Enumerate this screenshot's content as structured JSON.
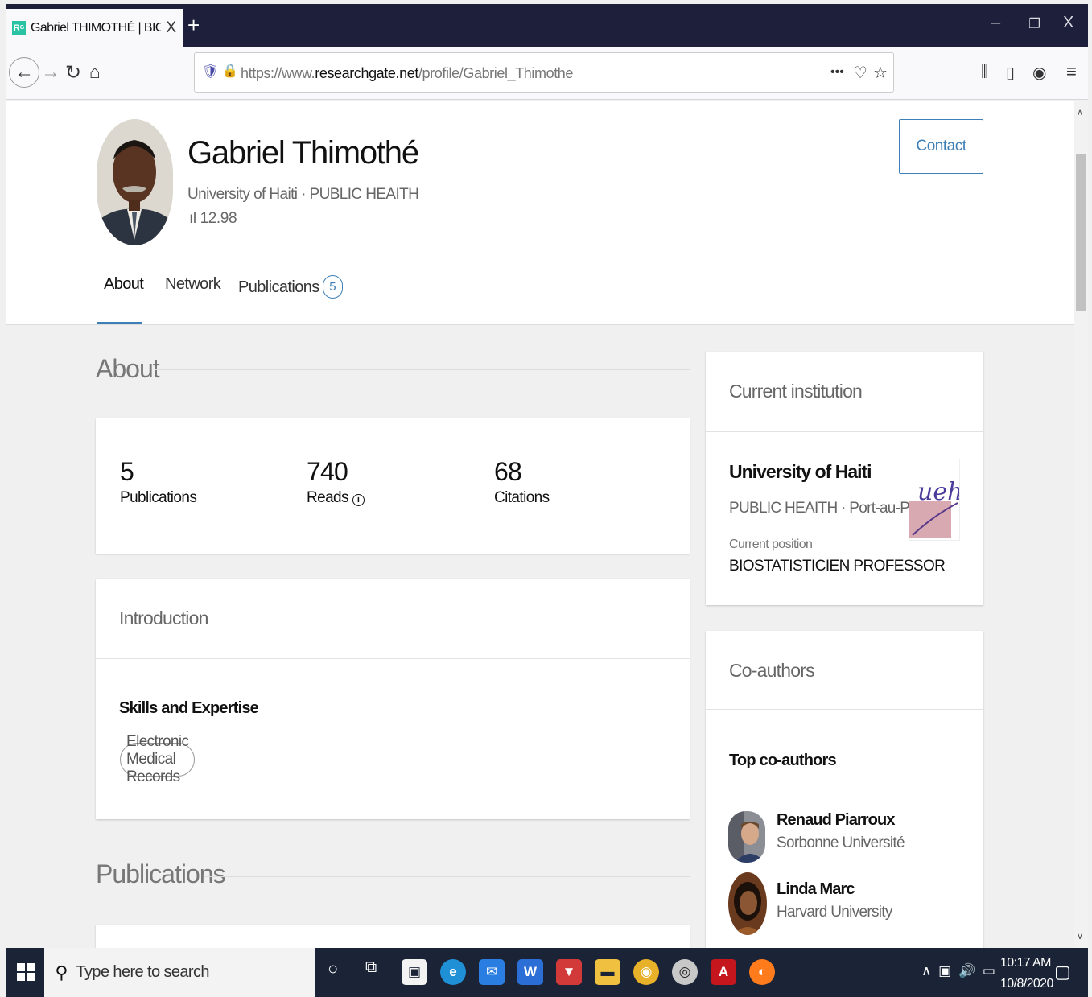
{
  "browser": {
    "tab_title": "Gabriel THIMOTHÉ | BIOSTATISTICIEN PROFESSOR",
    "tab_close": "X",
    "new_tab": "+",
    "url_prefix": "https://www.",
    "url_domain": "researchgate.net",
    "url_path": "/profile/Gabriel_Thimothe",
    "more": "•••"
  },
  "profile": {
    "name": "Gabriel Thimothé",
    "institution_line": "University of Haiti · PUBLIC HEAITH",
    "score": "12.98",
    "contact_label": "Contact"
  },
  "tabs": {
    "about": "About",
    "network": "Network",
    "publications": "Publications",
    "publications_count": "5"
  },
  "about": {
    "title": "About",
    "stats": [
      {
        "value": "5",
        "label": "Publications"
      },
      {
        "value": "740",
        "label": "Reads"
      },
      {
        "value": "68",
        "label": "Citations"
      }
    ],
    "introduction": "Introduction",
    "skills_title": "Skills and Expertise",
    "skills": [
      "Electronic Medical Records"
    ]
  },
  "publications_section": {
    "title": "Publications"
  },
  "institution": {
    "heading": "Current institution",
    "name": "University of Haiti",
    "detail": "PUBLIC HEAITH · Port-au-Prince, ...",
    "position_label": "Current position",
    "position": "BIOSTATISTICIEN PROFESSOR",
    "logo_text": "ueh"
  },
  "coauthors": {
    "heading": "Co-authors",
    "top_label": "Top co-authors",
    "list": [
      {
        "name": "Renaud Piarroux",
        "affiliation": "Sorbonne Université"
      },
      {
        "name": "Linda Marc",
        "affiliation": "Harvard University"
      }
    ]
  },
  "taskbar": {
    "search_placeholder": "Type here to search",
    "time": "10:17 AM",
    "date": "10/8/2020"
  },
  "colors": {
    "accent": "#3d7fb6",
    "tabstrip": "#1e1f3a",
    "taskbar": "#1b2437"
  }
}
